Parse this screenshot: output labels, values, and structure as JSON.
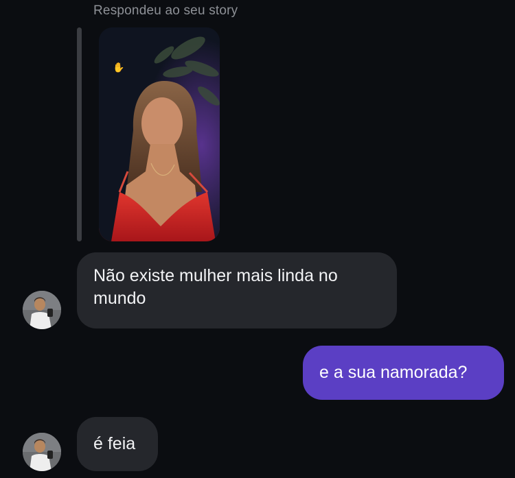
{
  "chat": {
    "story_reply_label": "Respondeu ao seu story",
    "messages": [
      {
        "direction": "incoming",
        "text": "Não existe mulher mais linda no mundo"
      },
      {
        "direction": "outgoing",
        "text": "e a sua namorada?"
      },
      {
        "direction": "incoming",
        "text": "é feia"
      }
    ],
    "colors": {
      "background": "#0b0d11",
      "incoming_bubble": "#25272c",
      "outgoing_bubble": "#5b3fc4",
      "secondary_text": "#8e9197"
    },
    "icons": [
      "story-thumbnail",
      "heart-hands-sticker",
      "avatar"
    ]
  }
}
